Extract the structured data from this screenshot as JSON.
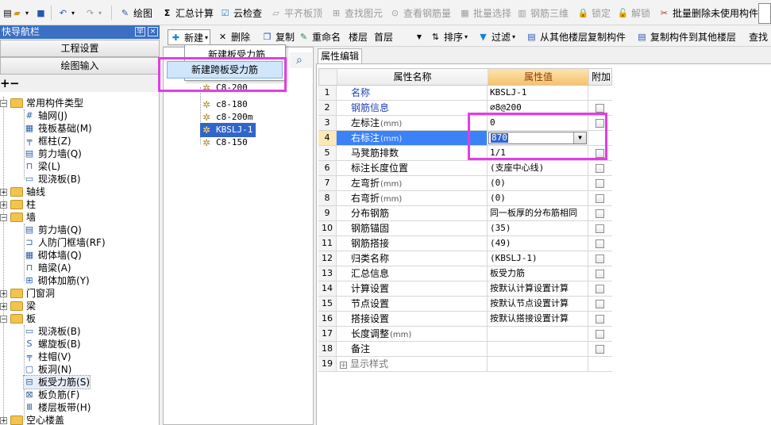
{
  "toolbar": {
    "items": [
      {
        "icon": "✎",
        "label": "绘图"
      },
      {
        "icon": "Σ",
        "label": "汇总计算"
      },
      {
        "icon": "☑",
        "label": "云检查"
      },
      {
        "icon": "▱",
        "label": "平齐板顶"
      },
      {
        "icon": "⊞",
        "label": "查找图元"
      },
      {
        "icon": "⊙",
        "label": "查看钢筋量"
      },
      {
        "icon": "▦",
        "label": "批量选择"
      },
      {
        "icon": "▥",
        "label": "钢筋三维"
      },
      {
        "icon": "🔒",
        "label": "锁定"
      },
      {
        "icon": "🔓",
        "label": "解锁"
      },
      {
        "icon": "✂",
        "label": "批量删除未使用构件"
      }
    ]
  },
  "nav": {
    "title": "快导航栏",
    "pin_glyph": "早",
    "close_glyph": "×",
    "section_project": "工程设置",
    "section_drawing": "绘图输入",
    "expand_all": "+",
    "collapse_all": "−"
  },
  "tree": {
    "common": {
      "label": "常用构件类型"
    },
    "common_items": [
      {
        "icon": "#",
        "label": "轴网",
        "key": "(J)"
      },
      {
        "icon": "▦",
        "label": "筏板基础",
        "key": "(M)"
      },
      {
        "icon": "╤",
        "label": "框柱",
        "key": "(Z)"
      },
      {
        "icon": "▤",
        "label": "剪力墙",
        "key": "(Q)"
      },
      {
        "icon": "⊓",
        "label": "梁",
        "key": "(L)"
      },
      {
        "icon": "▭",
        "label": "现浇板",
        "key": "(B)"
      }
    ],
    "axis": {
      "label": "轴线"
    },
    "column": {
      "label": "柱"
    },
    "wall": {
      "label": "墙"
    },
    "wall_items": [
      {
        "icon": "▤",
        "label": "剪力墙",
        "key": "(Q)"
      },
      {
        "icon": "⊐",
        "label": "人防门框墙",
        "key": "(RF)"
      },
      {
        "icon": "▦",
        "label": "砌体墙",
        "key": "(Q)"
      },
      {
        "icon": "⊓",
        "label": "暗梁",
        "key": "(A)"
      },
      {
        "icon": "⊞",
        "label": "砌体加筋",
        "key": "(Y)"
      }
    ],
    "door": {
      "label": "门窗洞"
    },
    "beam": {
      "label": "梁"
    },
    "slab": {
      "label": "板"
    },
    "slab_items": [
      {
        "icon": "▭",
        "label": "现浇板",
        "key": "(B)"
      },
      {
        "icon": "S",
        "label": "螺旋板",
        "key": "(B)"
      },
      {
        "icon": "╤",
        "label": "柱帽",
        "key": "(V)"
      },
      {
        "icon": "▢",
        "label": "板洞",
        "key": "(N)"
      },
      {
        "icon": "⊟",
        "label": "板受力筋",
        "key": "(S)"
      },
      {
        "icon": "⊠",
        "label": "板负筋",
        "key": "(F)"
      },
      {
        "icon": "Ⅲ",
        "label": "楼层板带",
        "key": "(H)"
      }
    ],
    "hollow": {
      "label": "空心楼盖"
    }
  },
  "midbar": {
    "new_label": "新建",
    "delete_label": "删除",
    "copy_label": "复制",
    "rename_label": "重命名",
    "floor_label": "楼层",
    "floor_value": "首层",
    "sort_label": "排序",
    "filter_label": "过滤",
    "copy_from_label": "从其他楼层复制构件",
    "copy_to_label": "复制构件到其他楼层",
    "find_label": "查找"
  },
  "popup": {
    "item1": "新建板受力筋",
    "item2": "新建跨板受力筋"
  },
  "components": [
    {
      "label": "C8-200"
    },
    {
      "label": "c8-180"
    },
    {
      "label": "c8-200m"
    },
    {
      "label": "KBSLJ-1"
    },
    {
      "label": "C8-150"
    }
  ],
  "props": {
    "tab_label": "属性编辑",
    "col_name": "属性名称",
    "col_value": "属性值",
    "col_extra": "附加",
    "rows": [
      {
        "num": "1",
        "name": "名称",
        "unit": "",
        "value": "KBSLJ-1"
      },
      {
        "num": "2",
        "name": "钢筋信息",
        "unit": "",
        "value": "⌀8@200"
      },
      {
        "num": "3",
        "name": "左标注",
        "unit": "(mm)",
        "value": "0"
      },
      {
        "num": "4",
        "name": "右标注",
        "unit": "(mm)",
        "value": "870"
      },
      {
        "num": "5",
        "name": "马凳筋排数",
        "unit": "",
        "value": "1/1"
      },
      {
        "num": "6",
        "name": "标注长度位置",
        "unit": "",
        "value": "(支座中心线)"
      },
      {
        "num": "7",
        "name": "左弯折",
        "unit": "(mm)",
        "value": "(0)"
      },
      {
        "num": "8",
        "name": "右弯折",
        "unit": "(mm)",
        "value": "(0)"
      },
      {
        "num": "9",
        "name": "分布钢筋",
        "unit": "",
        "value": "同一板厚的分布筋相同"
      },
      {
        "num": "10",
        "name": "钢筋锚固",
        "unit": "",
        "value": "(35)"
      },
      {
        "num": "11",
        "name": "钢筋搭接",
        "unit": "",
        "value": "(49)"
      },
      {
        "num": "12",
        "name": "归类名称",
        "unit": "",
        "value": "(KBSLJ-1)"
      },
      {
        "num": "13",
        "name": "汇总信息",
        "unit": "",
        "value": "板受力筋"
      },
      {
        "num": "14",
        "name": "计算设置",
        "unit": "",
        "value": "按默认计算设置计算"
      },
      {
        "num": "15",
        "name": "节点设置",
        "unit": "",
        "value": "按默认节点设置计算"
      },
      {
        "num": "16",
        "name": "搭接设置",
        "unit": "",
        "value": "按默认搭接设置计算"
      },
      {
        "num": "17",
        "name": "长度调整",
        "unit": "(mm)",
        "value": ""
      },
      {
        "num": "18",
        "name": "备注",
        "unit": "",
        "value": ""
      },
      {
        "num": "19",
        "name": "显示样式",
        "unit": "",
        "value": ""
      }
    ]
  },
  "colors": {
    "highlight": "#e63be6",
    "nav_title": "#3a6fc4",
    "selection": "#3166c9"
  }
}
